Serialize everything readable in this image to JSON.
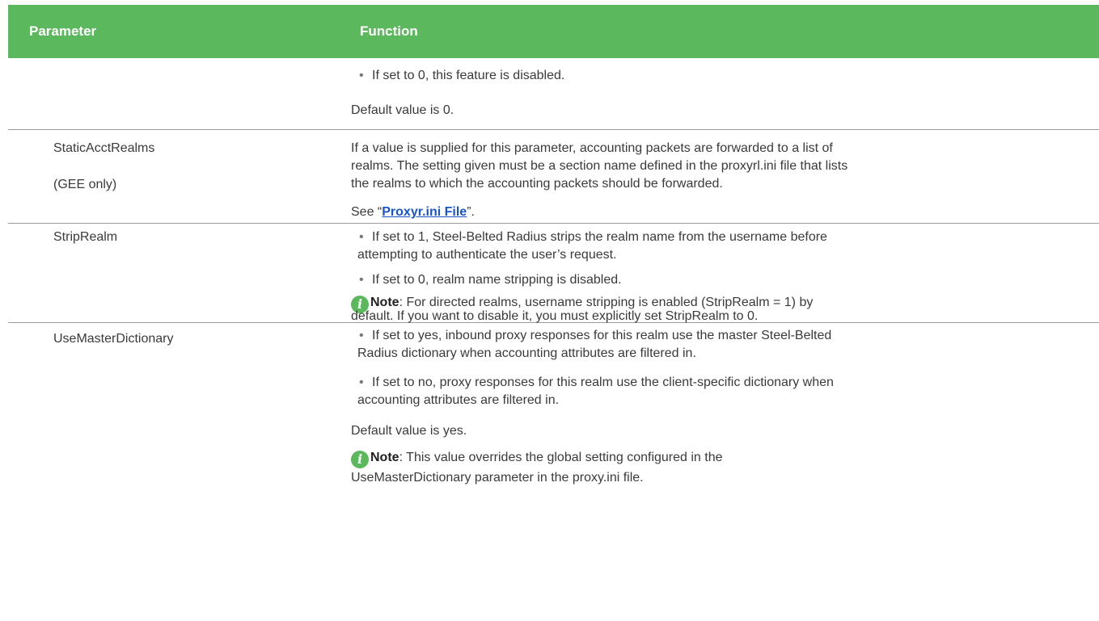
{
  "header": {
    "col1": "Parameter",
    "col2": "Function"
  },
  "rows": [
    {
      "param": "",
      "bullet1": "If set to 0, this feature is disabled.",
      "default": "Default value is 0."
    },
    {
      "param": "StaticAcctRealms",
      "param_note": "(GEE only)",
      "desc_line1": "If a value is supplied for this parameter, accounting packets are forwarded to a list of",
      "desc_line2": "realms. The setting given must be a section name defined in the proxyrl.ini file that lists",
      "desc_line3": "the realms to which the accounting packets should be forwarded.",
      "see_prefix": "See “",
      "see_link": "Proxyr.ini File",
      "see_suffix": "”."
    },
    {
      "param": "StripRealm",
      "bullet1_line1": "If set to 1, Steel-Belted Radius strips the realm name from the username before",
      "bullet1_line2": "attempting to authenticate the user’s request.",
      "bullet2": "If set to 0, realm name stripping is disabled.",
      "note_label": "Note",
      "note_line1": ": For directed realms, username stripping is enabled (StripRealm = 1) by",
      "note_line2": "default. If   you want to disable it, you must explicitly set StripRealm to 0."
    },
    {
      "param": "UseMasterDictionary",
      "bullet1_line1": "If set to yes, inbound proxy responses for this realm use the master Steel-Belted",
      "bullet1_line2": "Radius dictionary when accounting attributes are filtered in.",
      "bullet2_line1": "If set to no, proxy responses for this realm use the client-specific dictionary when",
      "bullet2_line2": "accounting attributes are filtered in.",
      "default": "Default value is yes.",
      "note_label": "Note",
      "note_line1": ": This value overrides the global setting configured in the",
      "note_line2": "UseMasterDictionary  parameter in the proxy.ini file."
    }
  ],
  "bullet_char": "•",
  "note_icon_glyph": "i",
  "colors": {
    "header_bg": "#5cb85c",
    "link": "#1a55c8",
    "divider": "#9a9a9a"
  }
}
